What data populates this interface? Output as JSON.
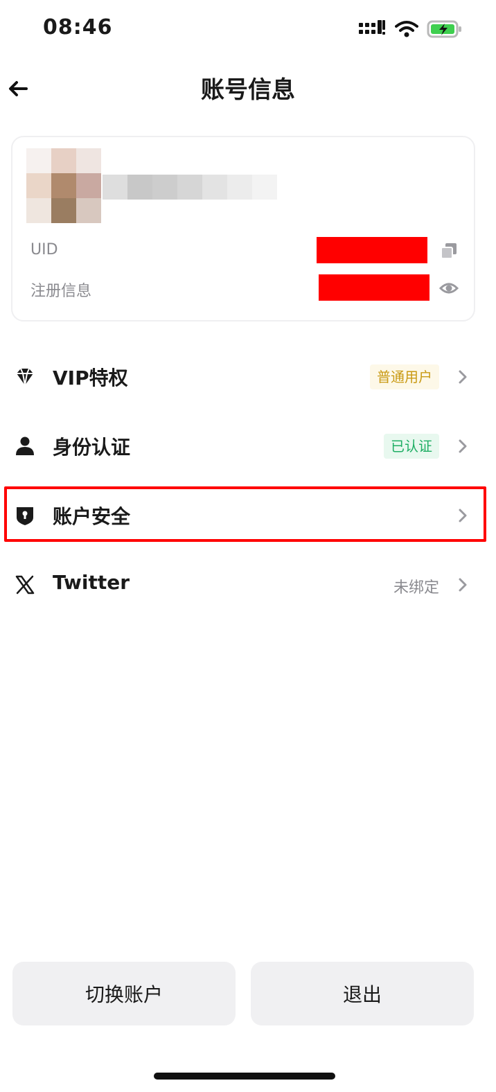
{
  "status_bar": {
    "time": "08:46",
    "icons": [
      "cellular-signal-icon",
      "wifi-icon",
      "battery-charging-icon"
    ]
  },
  "nav": {
    "title": "账号信息",
    "back_icon": "arrow-left-icon"
  },
  "profile": {
    "uid_label": "UID",
    "registration_label": "注册信息",
    "copy_icon": "copy-icon",
    "eye_icon": "eye-icon"
  },
  "menu": {
    "items": [
      {
        "label": "VIP特权",
        "icon": "diamond-icon",
        "status": "普通用户",
        "status_style": "vip"
      },
      {
        "label": "身份认证",
        "icon": "user-icon",
        "status": "已认证",
        "status_style": "verified"
      },
      {
        "label": "账户安全",
        "icon": "shield-lock-icon",
        "status": "",
        "status_style": "none"
      },
      {
        "label": "Twitter",
        "icon": "x-logo-icon",
        "status": "未绑定",
        "status_style": "plain"
      }
    ]
  },
  "buttons": {
    "switch_account": "切换账户",
    "logout": "退出"
  },
  "colors": {
    "accent_highlight": "#ff0000",
    "vip_text": "#c99a14",
    "verified_text": "#1fae64"
  }
}
